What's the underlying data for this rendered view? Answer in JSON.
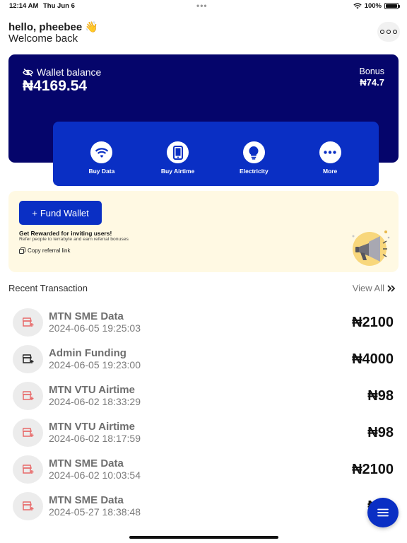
{
  "status_bar": {
    "time": "12:14 AM",
    "date": "Thu Jun 6",
    "battery": "100%"
  },
  "header": {
    "greeting": "hello, pheebee",
    "greeting_icon": "waving-hand-emoji",
    "welcome": "Welcome back",
    "more_icon": "more-dots-icon"
  },
  "wallet": {
    "label": "Wallet balance",
    "amount": "₦4169.54",
    "bonus_label": "Bonus",
    "bonus_amount": "₦74.7",
    "bg_color": "#05056b"
  },
  "quick_actions": [
    {
      "label": "Buy Data",
      "icon": "wifi-icon"
    },
    {
      "label": "Buy Airtime",
      "icon": "phone-icon"
    },
    {
      "label": "Electricity",
      "icon": "bulb-icon"
    },
    {
      "label": "More",
      "icon": "more-dots-icon"
    }
  ],
  "promo": {
    "fund_button": "Fund Wallet",
    "title": "Get Rewarded for inviting users!",
    "subtitle": "Refer people to terrabyte and earn referral bonuses",
    "copy_link": "Copy referral link",
    "bg_color": "#fff9e3"
  },
  "transactions_section": {
    "title": "Recent Transaction",
    "view_all": "View All"
  },
  "transactions": [
    {
      "title": "MTN SME Data",
      "date": "2024-06-05 19:25:03",
      "amount": "₦2100",
      "icon_color": "#e86a6a"
    },
    {
      "title": "Admin Funding",
      "date": "2024-06-05 19:23:00",
      "amount": "₦4000",
      "icon_color": "#222222"
    },
    {
      "title": "MTN VTU Airtime",
      "date": "2024-06-02 18:33:29",
      "amount": "₦98",
      "icon_color": "#e86a6a"
    },
    {
      "title": "MTN VTU Airtime",
      "date": "2024-06-02 18:17:59",
      "amount": "₦98",
      "icon_color": "#e86a6a"
    },
    {
      "title": "MTN SME Data",
      "date": "2024-06-02 10:03:54",
      "amount": "₦2100",
      "icon_color": "#e86a6a"
    },
    {
      "title": "MTN SME Data",
      "date": "2024-05-27 18:38:48",
      "amount": "₦21",
      "icon_color": "#e86a6a"
    }
  ],
  "accent_color": "#0a2fc4"
}
